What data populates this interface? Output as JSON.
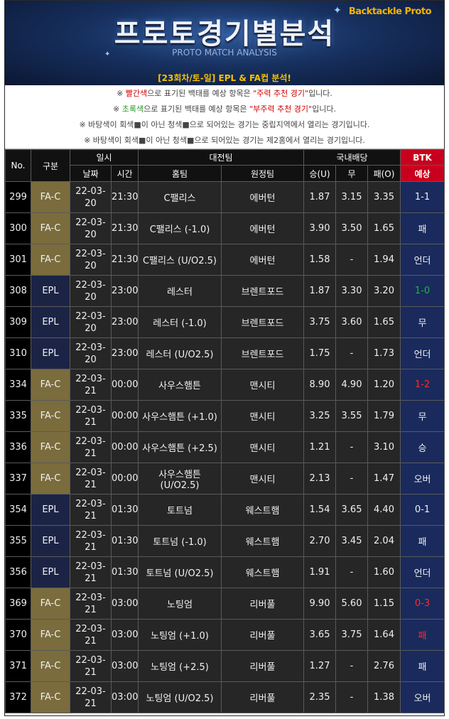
{
  "header": {
    "brand": "Backtackle Proto",
    "title": "프로토경기별분석",
    "subtitle": "PROTO MATCH ANALYSIS",
    "round_title": "[23회차/토-일] EPL & FA컵 분석!"
  },
  "notes": {
    "n1": {
      "pre": "※ ",
      "hl": "빨간색",
      "mid": "으로 표기된 백태를 예상 항목은 ",
      "q": "\"주력 추천 경기\"",
      "post": "입니다."
    },
    "n2": {
      "pre": "※ ",
      "hl": "초록색",
      "mid": "으로 표기된 백태를 예상 항목은 ",
      "q": "\"부주력 추천 경기\"",
      "post": "입니다."
    },
    "n3": "※ 바탕색이 회색■이 아닌 청색■으로 되어있는 경기는 중립지역에서 열리는 경기입니다.",
    "n4": "※ 바탕색이 회색■이 아닌 청색■으로 되어있는 경기는 제2홈에서 열리는 경기입니다."
  },
  "table": {
    "headers": {
      "no": "No.",
      "category": "구분",
      "datetime": "일시",
      "teams": "대전팀",
      "odds": "국내배당",
      "btk": "BTK",
      "date": "날짜",
      "time": "시간",
      "home": "홈팀",
      "away": "원정팀",
      "win": "승(U)",
      "draw": "무",
      "lose": "패(O)",
      "predict": "예상"
    },
    "rows": [
      {
        "no": "299",
        "cat": "FA-C",
        "date": "22-03-20",
        "time": "21:30",
        "home": "C팰리스",
        "away": "에버턴",
        "win": "1.87",
        "draw": "3.15",
        "lose": "3.35",
        "pred": "1-1",
        "pred_color": "white"
      },
      {
        "no": "300",
        "cat": "FA-C",
        "date": "22-03-20",
        "time": "21:30",
        "home": "C팰리스 (-1.0)",
        "away": "에버턴",
        "win": "3.90",
        "draw": "3.50",
        "lose": "1.65",
        "pred": "패",
        "pred_color": "white"
      },
      {
        "no": "301",
        "cat": "FA-C",
        "date": "22-03-20",
        "time": "21:30",
        "home": "C팰리스 (U/O2.5)",
        "away": "에버턴",
        "win": "1.58",
        "draw": "-",
        "lose": "1.94",
        "pred": "언더",
        "pred_color": "white"
      },
      {
        "no": "308",
        "cat": "EPL",
        "date": "22-03-20",
        "time": "23:00",
        "home": "레스터",
        "away": "브렌트포드",
        "win": "1.87",
        "draw": "3.30",
        "lose": "3.20",
        "pred": "1-0",
        "pred_color": "green"
      },
      {
        "no": "309",
        "cat": "EPL",
        "date": "22-03-20",
        "time": "23:00",
        "home": "레스터 (-1.0)",
        "away": "브렌트포드",
        "win": "3.75",
        "draw": "3.60",
        "lose": "1.65",
        "pred": "무",
        "pred_color": "white"
      },
      {
        "no": "310",
        "cat": "EPL",
        "date": "22-03-20",
        "time": "23:00",
        "home": "레스터 (U/O2.5)",
        "away": "브렌트포드",
        "win": "1.75",
        "draw": "-",
        "lose": "1.73",
        "pred": "언더",
        "pred_color": "white"
      },
      {
        "no": "334",
        "cat": "FA-C",
        "date": "22-03-21",
        "time": "00:00",
        "home": "사우스햄튼",
        "away": "맨시티",
        "win": "8.90",
        "draw": "4.90",
        "lose": "1.20",
        "pred": "1-2",
        "pred_color": "red"
      },
      {
        "no": "335",
        "cat": "FA-C",
        "date": "22-03-21",
        "time": "00:00",
        "home": "사우스햄튼 (+1.0)",
        "away": "맨시티",
        "win": "3.25",
        "draw": "3.55",
        "lose": "1.79",
        "pred": "무",
        "pred_color": "white"
      },
      {
        "no": "336",
        "cat": "FA-C",
        "date": "22-03-21",
        "time": "00:00",
        "home": "사우스햄튼 (+2.5)",
        "away": "맨시티",
        "win": "1.21",
        "draw": "-",
        "lose": "3.10",
        "pred": "승",
        "pred_color": "white"
      },
      {
        "no": "337",
        "cat": "FA-C",
        "date": "22-03-21",
        "time": "00:00",
        "home": "사우스햄튼 (U/O2.5)",
        "away": "맨시티",
        "win": "2.13",
        "draw": "-",
        "lose": "1.47",
        "pred": "오버",
        "pred_color": "white"
      },
      {
        "no": "354",
        "cat": "EPL",
        "date": "22-03-21",
        "time": "01:30",
        "home": "토트넘",
        "away": "웨스트햄",
        "win": "1.54",
        "draw": "3.65",
        "lose": "4.40",
        "pred": "0-1",
        "pred_color": "white"
      },
      {
        "no": "355",
        "cat": "EPL",
        "date": "22-03-21",
        "time": "01:30",
        "home": "토트넘 (-1.0)",
        "away": "웨스트햄",
        "win": "2.70",
        "draw": "3.45",
        "lose": "2.04",
        "pred": "패",
        "pred_color": "white"
      },
      {
        "no": "356",
        "cat": "EPL",
        "date": "22-03-21",
        "time": "01:30",
        "home": "토트넘 (U/O2.5)",
        "away": "웨스트햄",
        "win": "1.91",
        "draw": "-",
        "lose": "1.60",
        "pred": "언더",
        "pred_color": "white"
      },
      {
        "no": "369",
        "cat": "FA-C",
        "date": "22-03-21",
        "time": "03:00",
        "home": "노팅엄",
        "away": "리버풀",
        "win": "9.90",
        "draw": "5.60",
        "lose": "1.15",
        "pred": "0-3",
        "pred_color": "red"
      },
      {
        "no": "370",
        "cat": "FA-C",
        "date": "22-03-21",
        "time": "03:00",
        "home": "노팅엄 (+1.0)",
        "away": "리버풀",
        "win": "3.65",
        "draw": "3.75",
        "lose": "1.64",
        "pred": "패",
        "pred_color": "red"
      },
      {
        "no": "371",
        "cat": "FA-C",
        "date": "22-03-21",
        "time": "03:00",
        "home": "노팅엄 (+2.5)",
        "away": "리버풀",
        "win": "1.27",
        "draw": "-",
        "lose": "2.76",
        "pred": "패",
        "pred_color": "white"
      },
      {
        "no": "372",
        "cat": "FA-C",
        "date": "22-03-21",
        "time": "03:00",
        "home": "노팅엄 (U/O2.5)",
        "away": "리버풀",
        "win": "2.35",
        "draw": "-",
        "lose": "1.38",
        "pred": "오버",
        "pred_color": "white"
      }
    ]
  }
}
